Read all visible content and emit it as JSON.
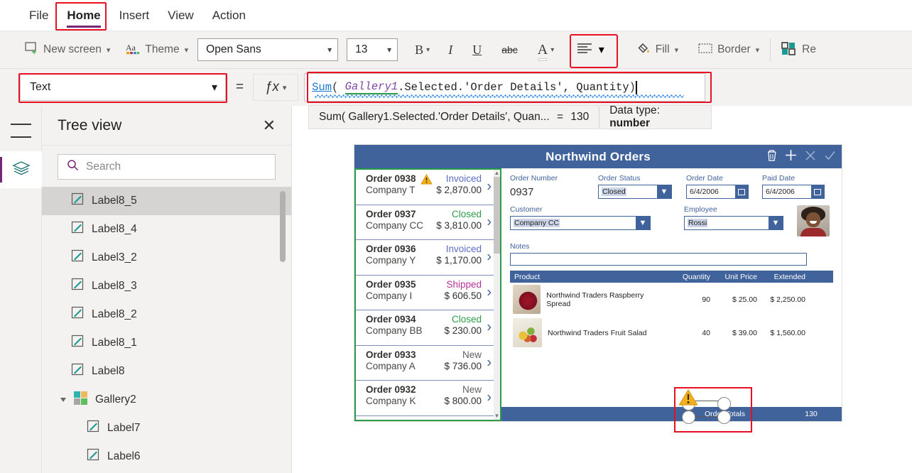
{
  "menu": {
    "items": [
      {
        "label": "File",
        "active": false
      },
      {
        "label": "Home",
        "active": true
      },
      {
        "label": "Insert",
        "active": false
      },
      {
        "label": "View",
        "active": false
      },
      {
        "label": "Action",
        "active": false
      }
    ]
  },
  "ribbon": {
    "new_screen": "New screen",
    "theme": "Theme",
    "font_family": "Open Sans",
    "font_size": "13",
    "bold": "B",
    "italic": "I",
    "underline": "U",
    "strikethrough": "abc",
    "font_color": "A",
    "align": "align-icon",
    "fill": "Fill",
    "border": "Border",
    "reorder": "Re",
    "chevron": "⌄"
  },
  "formula": {
    "property": "Text",
    "equals": "=",
    "fx": "ƒx",
    "tokens": {
      "fn": "Sum",
      "open_paren": "(",
      "control": "Gallery1",
      "rest": ".Selected.'Order Details', Quantity ",
      "close_paren": ")"
    },
    "full_text": "Sum( Gallery1.Selected.'Order Details', Quantity )"
  },
  "result": {
    "expression": "Sum( Gallery1.Selected.'Order Details', Quan...",
    "equals": "=",
    "value": "130",
    "datatype_label": "Data type:",
    "datatype_value": "number"
  },
  "tree": {
    "title": "Tree view",
    "close": "✕",
    "search_placeholder": "Search",
    "items": [
      {
        "label": "Label8_5",
        "icon": "label-icon",
        "level": 1,
        "selected": true
      },
      {
        "label": "Label8_4",
        "icon": "label-icon",
        "level": 1,
        "selected": false
      },
      {
        "label": "Label3_2",
        "icon": "label-icon",
        "level": 1,
        "selected": false
      },
      {
        "label": "Label8_3",
        "icon": "label-icon",
        "level": 1,
        "selected": false
      },
      {
        "label": "Label8_2",
        "icon": "label-icon",
        "level": 1,
        "selected": false
      },
      {
        "label": "Label8_1",
        "icon": "label-icon",
        "level": 1,
        "selected": false
      },
      {
        "label": "Label8",
        "icon": "label-icon",
        "level": 1,
        "selected": false
      },
      {
        "label": "Gallery2",
        "icon": "gallery-icon",
        "level": 0,
        "selected": false,
        "expanded": true
      },
      {
        "label": "Label7",
        "icon": "label-icon",
        "level": 2,
        "selected": false
      },
      {
        "label": "Label6",
        "icon": "label-icon",
        "level": 2,
        "selected": false
      }
    ]
  },
  "app": {
    "title": "Northwind Orders",
    "header_icons": [
      "trash-icon",
      "plus-icon",
      "cancel-icon",
      "check-icon"
    ],
    "gallery": [
      {
        "order": "Order 0938",
        "company": "Company T",
        "status": "Invoiced",
        "status_color": "#5b6fc4",
        "amount": "$ 2,870.00",
        "warning": true
      },
      {
        "order": "Order 0937",
        "company": "Company CC",
        "status": "Closed",
        "status_color": "#2d9c4a",
        "amount": "$ 3,810.00",
        "warning": false
      },
      {
        "order": "Order 0936",
        "company": "Company Y",
        "status": "Invoiced",
        "status_color": "#5b6fc4",
        "amount": "$ 1,170.00",
        "warning": false
      },
      {
        "order": "Order 0935",
        "company": "Company I",
        "status": "Shipped",
        "status_color": "#b5329b",
        "amount": "$ 606.50",
        "warning": false
      },
      {
        "order": "Order 0934",
        "company": "Company BB",
        "status": "Closed",
        "status_color": "#2d9c4a",
        "amount": "$ 230.00",
        "warning": false
      },
      {
        "order": "Order 0933",
        "company": "Company A",
        "status": "New",
        "status_color": "#5f5f5f",
        "amount": "$ 736.00",
        "warning": false
      },
      {
        "order": "Order 0932",
        "company": "Company K",
        "status": "New",
        "status_color": "#5f5f5f",
        "amount": "$ 800.00",
        "warning": false
      }
    ],
    "form": {
      "order_number_label": "Order Number",
      "order_number_value": "0937",
      "order_status_label": "Order Status",
      "order_status_value": "Closed",
      "order_date_label": "Order Date",
      "order_date_value": "6/4/2006",
      "paid_date_label": "Paid Date",
      "paid_date_value": "6/4/2006",
      "customer_label": "Customer",
      "customer_value": "Company CC",
      "employee_label": "Employee",
      "employee_value": "Rossi",
      "notes_label": "Notes",
      "notes_value": ""
    },
    "products": {
      "headers": [
        "Product",
        "Quantity",
        "Unit Price",
        "Extended"
      ],
      "rows": [
        {
          "name": "Northwind Traders Raspberry Spread",
          "qty": "90",
          "unit_price": "$ 25.00",
          "extended": "$ 2,250.00",
          "thumb": "raspberry"
        },
        {
          "name": "Northwind Traders Fruit Salad",
          "qty": "40",
          "unit_price": "$ 39.00",
          "extended": "$ 1,560.00",
          "thumb": "fruit"
        }
      ]
    },
    "totals": {
      "label": "Order Totals",
      "value": "130"
    }
  },
  "colors": {
    "accent_purple": "#742774",
    "app_blue": "#41639c",
    "selection_red": "#e81123",
    "selection_green": "#2d9c4a"
  }
}
